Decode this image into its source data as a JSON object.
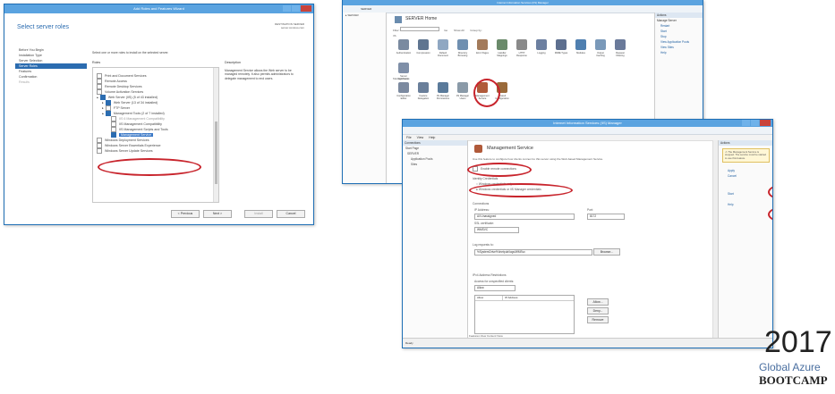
{
  "wizard": {
    "title": "Add Roles and Features Wizard",
    "heading": "Select server roles",
    "destination": "DESTINATION SERVER\nserver.contoso.com",
    "nav": [
      "Before You Begin",
      "Installation Type",
      "Server Selection",
      "Server Roles",
      "Features",
      "Confirmation",
      "Results"
    ],
    "instruction": "Select one or more roles to install on the selected server.",
    "roles_header": "Roles",
    "description_header": "Description",
    "description_text": "Management Service allows the Web server to be managed remotely. It also permits administrators to delegate management to end users.",
    "roles": [
      {
        "label": "Print and Document Services",
        "checked": false
      },
      {
        "label": "Remote Access",
        "checked": false
      },
      {
        "label": "Remote Desktop Services",
        "checked": false
      },
      {
        "label": "Volume Activation Services",
        "checked": false
      },
      {
        "label": "Web Server (IIS) (5 of 43 installed)",
        "checked": true
      },
      {
        "label": "Web Server (13 of 34 installed)",
        "checked": true
      },
      {
        "label": "FTP Server",
        "checked": false
      },
      {
        "label": "Management Tools (2 of 7 installed)",
        "checked": true
      },
      {
        "label": "IIS 6 Management Compatibility",
        "checked": false
      },
      {
        "label": "IIS Management Compatibility",
        "checked": false
      },
      {
        "label": "IIS Management Scripts and Tools",
        "checked": false
      },
      {
        "label": "Management Service",
        "checked": false
      },
      {
        "label": "Windows Deployment Services",
        "checked": false
      },
      {
        "label": "Windows Server Essentials Experience",
        "checked": false
      },
      {
        "label": "Windows Server Update Services",
        "checked": false
      }
    ],
    "buttons": {
      "previous": "< Previous",
      "next": "Next >",
      "install": "Install",
      "cancel": "Cancel"
    }
  },
  "iis_manager": {
    "title": "Internet Information Services (IIS) Manager",
    "address": "SERVER",
    "page_title": "SERVER Home",
    "filter_label": "Filter:",
    "go_label": "Go",
    "show_all_label": "Show All",
    "group_by_label": "Group by:",
    "section_iis": "IIS",
    "section_management": "Management",
    "features_iis": [
      "Authentication",
      "Compression",
      "Default Document",
      "Directory Browsing",
      "Error Pages",
      "Handler Mappings",
      "HTTP Response",
      "Logging",
      "MIME Types",
      "Modules",
      "Output Caching",
      "Request Filtering",
      "Server Certificates"
    ],
    "features_mgmt": [
      "Configuration Editor",
      "Feature Delegation",
      "IIS Manager Permissions",
      "IIS Manager Users",
      "Management Service",
      "Shared Configuration"
    ],
    "actions_header": "Actions",
    "actions": [
      "Manage Server",
      "Restart",
      "Start",
      "Stop",
      "View Application Pools",
      "View Sites",
      "Help"
    ]
  },
  "mgmt_service": {
    "title": "Internet Information Services (IIS) Manager",
    "menu": [
      "File",
      "View",
      "Help"
    ],
    "connections_header": "Connections",
    "tree": [
      "Start Page",
      "SERVER",
      "Application Pools",
      "Sites"
    ],
    "page_title": "Management Service",
    "page_desc": "Use this feature to configure how clients connect to this server using the Web-based Management Service.",
    "enable_remote": "Enable remote connections",
    "identity_header": "Identity Credentials",
    "identity_option1": "Windows credentials only",
    "identity_option2": "Windows credentials or IIS Manager credentials",
    "connections_header2": "Connections",
    "ip_label": "IP Address:",
    "ip_value": "All Unassigned",
    "port_label": "Port:",
    "port_value": "8172",
    "ssl_label": "SSL certificate:",
    "ssl_value": "WMSVC",
    "log_label": "Log requests to:",
    "log_value": "%SystemDrive%\\Inetpub\\logs\\WMSvc",
    "browse_button": "Browse...",
    "ip_restrictions_header": "IPv4 Address Restrictions",
    "access_label": "Access for unspecified clients:",
    "access_value": "Allow",
    "table_cols": [
      "Allow",
      "IP Address"
    ],
    "side_buttons": [
      "Allow...",
      "Deny...",
      "Remove"
    ],
    "actions_header": "Actions",
    "alert_text": "The Management Service is stopped. The service must be started to use this feature.",
    "actions": [
      "Apply",
      "Cancel",
      "Start",
      "Help"
    ],
    "status": "Ready",
    "bottom_tabs": "Features View  Content View"
  },
  "badge": {
    "year": "2017",
    "line1": "Global Azure",
    "line2": "BOOTCAMP"
  }
}
